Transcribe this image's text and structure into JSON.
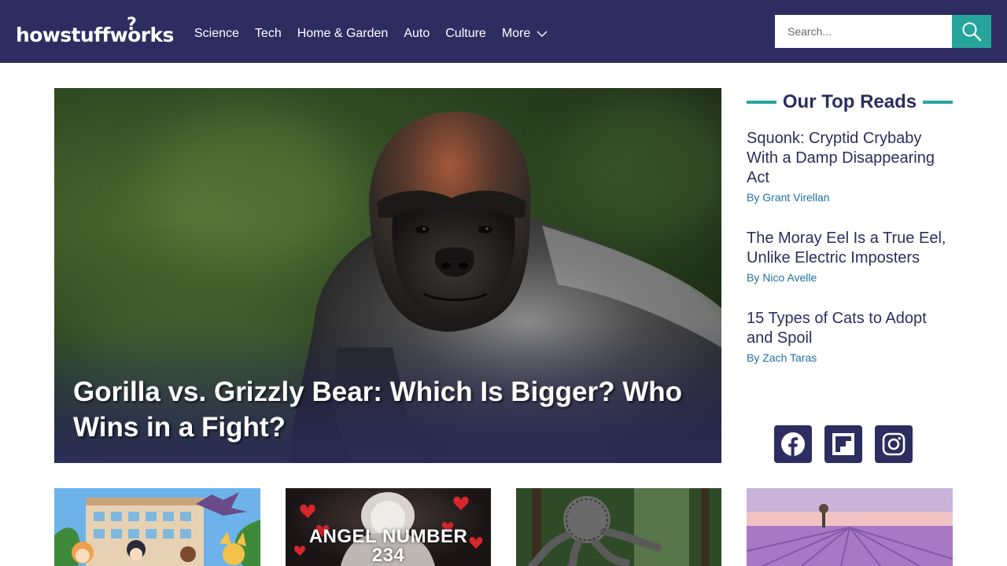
{
  "brand": {
    "logo_text": "howstuffworks",
    "logo_mark": "?"
  },
  "nav": {
    "items": [
      "Science",
      "Tech",
      "Home & Garden",
      "Auto",
      "Culture"
    ],
    "more_label": "More"
  },
  "search": {
    "placeholder": "Search...",
    "value": ""
  },
  "hero": {
    "title": "Gorilla vs. Grizzly Bear: Which Is Bigger? Who Wins in a Fight?"
  },
  "top_reads": {
    "heading": "Our Top Reads",
    "by_prefix": "By",
    "items": [
      {
        "title": "Squonk: Cryptid Crybaby With a Damp Disappearing Act",
        "author": "Grant Virellan"
      },
      {
        "title": "The Moray Eel Is a True Eel, Unlike Electric Imposters",
        "author": "Nico Avelle"
      },
      {
        "title": "15 Types of Cats to Adopt and Spoil",
        "author": "Zach Taras"
      }
    ]
  },
  "social": [
    "facebook-icon",
    "flipboard-icon",
    "instagram-icon"
  ],
  "cards": {
    "card2_text_line1": "ANGEL NUMBER",
    "card2_text_line2": "234"
  },
  "colors": {
    "header_bg": "#2d2d61",
    "accent_teal": "#26a59a",
    "link_blue": "#1e6fa8"
  }
}
